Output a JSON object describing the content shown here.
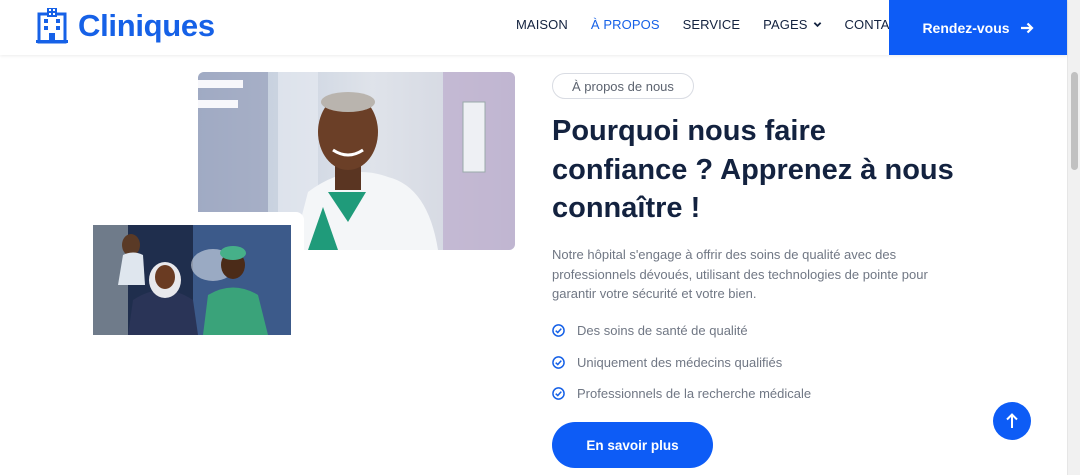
{
  "brand": {
    "name": "Cliniques",
    "icon": "hospital-building-icon",
    "color": "#1661e7"
  },
  "nav": {
    "items": [
      {
        "label": "MAISON",
        "active": false
      },
      {
        "label": "À PROPOS",
        "active": true
      },
      {
        "label": "SERVICE",
        "active": false
      },
      {
        "label": "PAGES",
        "active": false,
        "dropdown": true
      },
      {
        "label": "CONTACT",
        "active": false
      }
    ],
    "cta_label": "Rendez-vous",
    "cta_icon": "arrow-right-icon"
  },
  "about": {
    "tag": "À propos de nous",
    "heading_line1": "Pourquoi nous faire",
    "heading_line2": "confiance ? Apprenez à nous",
    "heading_line3": "connaître !",
    "description": "Notre hôpital s'engage à offrir des soins de qualité avec des professionnels dévoués, utilisant des technologies de pointe pour garantir votre sécurité et votre bien.",
    "features": [
      "Des soins de santé de qualité",
      "Uniquement des médecins qualifiés",
      "Professionnels de la recherche médicale"
    ],
    "button_label": "En savoir plus"
  },
  "images": {
    "main": "doctor-portrait-photo",
    "secondary": "medical-team-photo"
  },
  "colors": {
    "primary": "#0d5cf6",
    "heading": "#13223f",
    "text": "#707784",
    "accent": "#1661e7"
  }
}
